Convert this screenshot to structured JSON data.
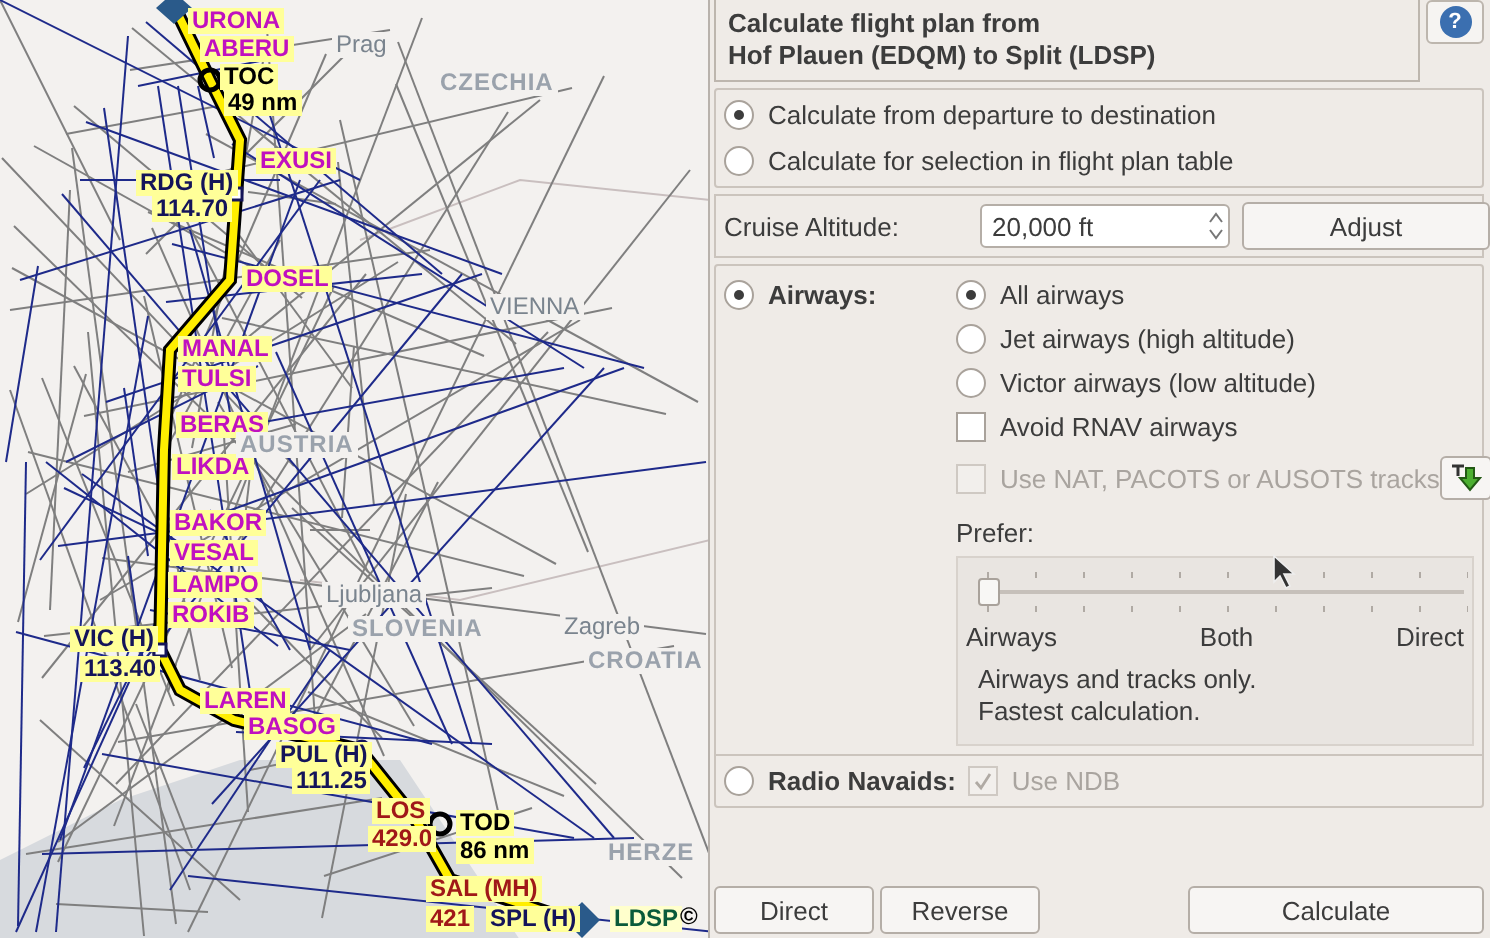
{
  "map": {
    "labels": [
      {
        "kind": "waypoint",
        "text": "URONA"
      },
      {
        "kind": "waypoint",
        "text": "ABERU"
      },
      {
        "kind": "marker",
        "text": "TOC"
      },
      {
        "kind": "distance",
        "text": "49 nm"
      },
      {
        "kind": "waypoint",
        "text": "EXUSI"
      },
      {
        "kind": "navaid",
        "text": "RDG (H)"
      },
      {
        "kind": "navaid",
        "text": "114.70"
      },
      {
        "kind": "waypoint",
        "text": "DOSEL"
      },
      {
        "kind": "waypoint",
        "text": "MANAL"
      },
      {
        "kind": "waypoint",
        "text": "TULSI"
      },
      {
        "kind": "waypoint",
        "text": "BERAS"
      },
      {
        "kind": "waypoint",
        "text": "LIKDA"
      },
      {
        "kind": "waypoint",
        "text": "BAKOR"
      },
      {
        "kind": "waypoint",
        "text": "VESAL"
      },
      {
        "kind": "waypoint",
        "text": "LAMPO"
      },
      {
        "kind": "waypoint",
        "text": "ROKIB"
      },
      {
        "kind": "navaid",
        "text": "VIC (H)"
      },
      {
        "kind": "navaid",
        "text": "113.40"
      },
      {
        "kind": "waypoint",
        "text": "LAREN"
      },
      {
        "kind": "waypoint",
        "text": "BASOG"
      },
      {
        "kind": "navaid",
        "text": "PUL (H)"
      },
      {
        "kind": "navaid",
        "text": "111.25"
      },
      {
        "kind": "ndb",
        "text": "LOS"
      },
      {
        "kind": "ndb",
        "text": "429.0"
      },
      {
        "kind": "marker",
        "text": "TOD"
      },
      {
        "kind": "distance",
        "text": "86 nm"
      },
      {
        "kind": "ndb",
        "text": "SAL (MH)"
      },
      {
        "kind": "ndb",
        "text": "421"
      },
      {
        "kind": "navaid",
        "text": "SPL (H)"
      },
      {
        "kind": "airport",
        "text": "LDSP"
      },
      {
        "kind": "country",
        "text": "CZECHIA"
      },
      {
        "kind": "city",
        "text": "Prag"
      },
      {
        "kind": "city",
        "text": "VIENNA"
      },
      {
        "kind": "country",
        "text": "AUSTRIA"
      },
      {
        "kind": "city",
        "text": "Ljubljana"
      },
      {
        "kind": "country",
        "text": "SLOVENIA"
      },
      {
        "kind": "city",
        "text": "Zagreb"
      },
      {
        "kind": "country",
        "text": "CROATIA"
      },
      {
        "kind": "country",
        "text": "HERZE"
      },
      {
        "kind": "copyright",
        "text": "©"
      }
    ]
  },
  "header": {
    "title_lines": [
      "Calculate flight plan from",
      "Hof Plauen (EDQM) to Split (LDSP)"
    ],
    "help_symbol": "?"
  },
  "calculation_mode": [
    {
      "label": "Calculate from departure to destination",
      "selected": true
    },
    {
      "label": "Calculate for selection in flight plan table",
      "selected": false
    }
  ],
  "cruise_altitude": {
    "label": "Cruise Altitude:",
    "value": "20,000 ft",
    "button": "Adjust"
  },
  "airways": {
    "label": "Airways:",
    "selected": true,
    "types": [
      {
        "label": "All airways",
        "selected": true
      },
      {
        "label": "Jet airways (high altitude)",
        "selected": false
      },
      {
        "label": "Victor airways (low altitude)",
        "selected": false
      }
    ],
    "avoid_rnav": {
      "label": "Avoid RNAV airways",
      "checked": false,
      "disabled": false
    },
    "use_tracks": {
      "label": "Use NAT, PACOTS or AUSOTS tracks",
      "checked": false,
      "disabled": true
    },
    "prefer": {
      "label": "Prefer:",
      "level": 0,
      "scale": [
        "Airways",
        "Both",
        "Direct"
      ],
      "description": [
        "Airways and tracks only.",
        "Fastest calculation."
      ]
    }
  },
  "radio_navaids": {
    "label": "Radio Navaids:",
    "selected": false,
    "use_ndb": {
      "label": "Use NDB",
      "checked": true,
      "disabled": true
    }
  },
  "buttons": [
    {
      "label": "Direct"
    },
    {
      "label": "Reverse"
    }
  ],
  "calculate_button": {
    "label": "Calculate"
  }
}
